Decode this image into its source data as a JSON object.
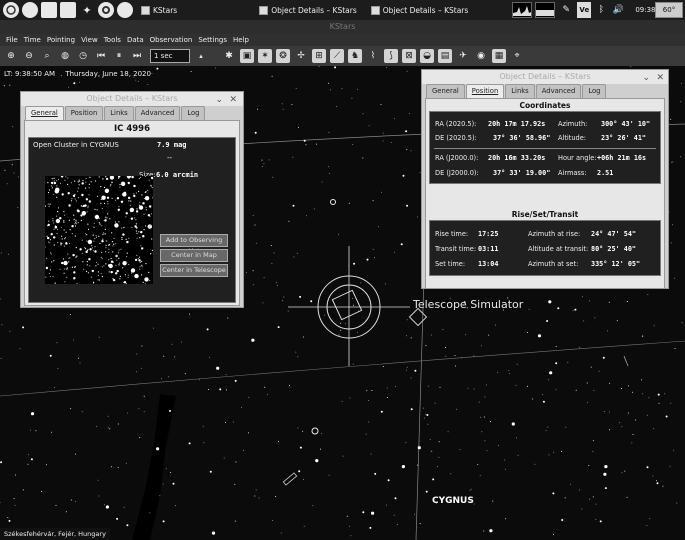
{
  "panel": {
    "tasks": [
      {
        "label": "KStars"
      },
      {
        "label": "Object Details – KStars"
      },
      {
        "label": "Object Details – KStars"
      }
    ],
    "clock": "09:38:51",
    "temperature": "60°"
  },
  "window_title": "KStars",
  "menu": [
    "File",
    "Time",
    "Pointing",
    "View",
    "Tools",
    "Data",
    "Observation",
    "Settings",
    "Help"
  ],
  "toolbar": {
    "time_step": "1 sec"
  },
  "sky": {
    "local_time": "LT: 9:38:50 AM",
    "date": "Thursday, June 18, 2020",
    "telescope_label": "Telescope Simulator",
    "constellation_label": "CYGNUS",
    "location": "Székesfehérvár, Fejér, Hungary"
  },
  "dialog_left": {
    "title": "Object Details – KStars",
    "tabs": [
      "General",
      "Position",
      "Links",
      "Advanced",
      "Log"
    ],
    "active_tab": "General",
    "object_name": "IC 4996",
    "type": "Open Cluster in CYGNUS",
    "magnitude": "7.9 mag",
    "distance": "--",
    "size_label": "Size:",
    "size_value": "6.0 arcmin",
    "buttons": [
      "Add to Observing List",
      "Center in Map",
      "Center in Telescope"
    ]
  },
  "dialog_right": {
    "title": "Object Details – KStars",
    "tabs": [
      "General",
      "Position",
      "Links",
      "Advanced",
      "Log"
    ],
    "active_tab": "Position",
    "coords_title": "Coordinates",
    "coords": {
      "ra_2020_label": "RA (2020.5):",
      "ra_2020": "20h 17m 17.92s",
      "az_label": "Azimuth:",
      "az": "300° 43' 10\"",
      "de_2020_label": "DE (2020.5):",
      "de_2020": "37° 36' 58.96\"",
      "alt_label": "Altitude:",
      "alt": "23° 26' 41\"",
      "ra_2000_label": "RA (J2000.0):",
      "ra_2000": "20h 16m 33.20s",
      "ha_label": "Hour angle:",
      "ha": "+06h 21m 16s",
      "de_2000_label": "DE (J2000.0):",
      "de_2000": "37° 33' 19.00\"",
      "airmass_label": "Airmass:",
      "airmass": "2.51"
    },
    "rst_title": "Rise/Set/Transit",
    "rst": {
      "rise_label": "Rise time:",
      "rise": "17:25",
      "az_rise_label": "Azimuth at rise:",
      "az_rise": "24° 47' 54\"",
      "transit_label": "Transit time:",
      "transit": "03:11",
      "alt_transit_label": "Altitude at transit:",
      "alt_transit": "80° 25' 40\"",
      "set_label": "Set time:",
      "set": "13:04",
      "az_set_label": "Azimuth at set:",
      "az_set": "335° 12' 05\""
    }
  }
}
